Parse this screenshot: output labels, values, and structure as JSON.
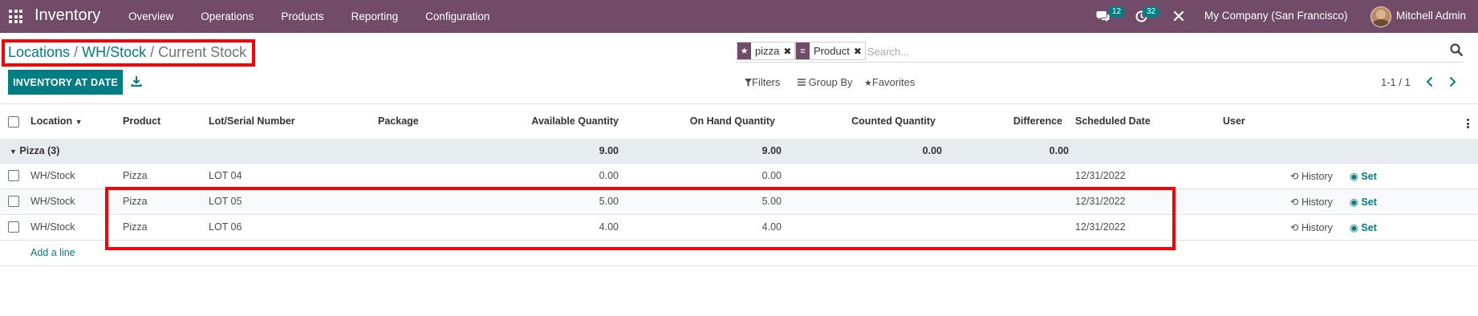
{
  "navbar": {
    "app_name": "Inventory",
    "menu": [
      "Overview",
      "Operations",
      "Products",
      "Reporting",
      "Configuration"
    ],
    "messages_count": "12",
    "activities_count": "32",
    "company": "My Company (San Francisco)",
    "user": "Mitchell Admin",
    "bg_color": "#714b67"
  },
  "breadcrumb": {
    "items": [
      "Locations",
      "WH/Stock"
    ],
    "separator": "/",
    "current": "Current Stock"
  },
  "search": {
    "facets": [
      {
        "icon": "star-icon",
        "label": "pizza"
      },
      {
        "icon": "list-icon",
        "label": "Product"
      }
    ],
    "placeholder": "Search..."
  },
  "toolbar": {
    "primary_button": "INVENTORY AT DATE",
    "filters": "Filters",
    "group_by": "Group By",
    "favorites": "Favorites"
  },
  "pager": {
    "value": "1-1 / 1"
  },
  "table": {
    "columns": [
      "Location",
      "Product",
      "Lot/Serial Number",
      "Package",
      "Available Quantity",
      "On Hand Quantity",
      "Counted Quantity",
      "Difference",
      "Scheduled Date",
      "User"
    ],
    "group": {
      "label": "Pizza (3)",
      "available": "9.00",
      "on_hand": "9.00",
      "counted": "0.00",
      "difference": "0.00"
    },
    "rows": [
      {
        "location": "WH/Stock",
        "product": "Pizza",
        "lot": "LOT 04",
        "available": "0.00",
        "on_hand": "0.00",
        "date": "12/31/2022"
      },
      {
        "location": "WH/Stock",
        "product": "Pizza",
        "lot": "LOT 05",
        "available": "5.00",
        "on_hand": "5.00",
        "date": "12/31/2022"
      },
      {
        "location": "WH/Stock",
        "product": "Pizza",
        "lot": "LOT 06",
        "available": "4.00",
        "on_hand": "4.00",
        "date": "12/31/2022"
      }
    ],
    "history_label": "History",
    "set_label": "Set",
    "add_line": "Add a line"
  },
  "colors": {
    "brand": "#714b67",
    "accent": "#017e84",
    "highlight": "#ff0000"
  }
}
